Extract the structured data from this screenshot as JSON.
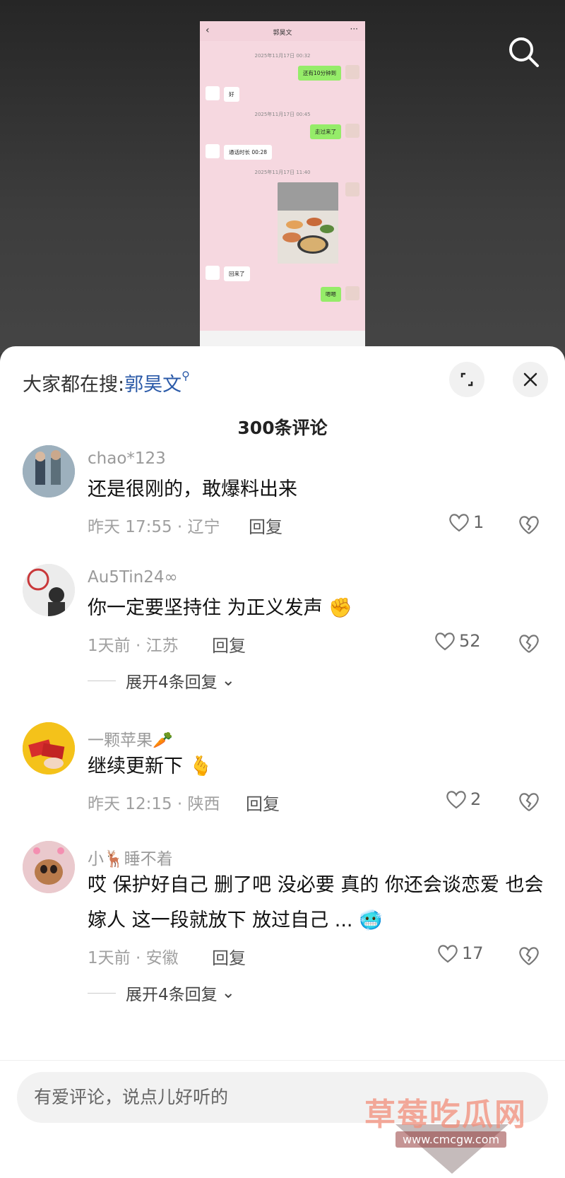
{
  "phone_chat": {
    "title": "郭昊文",
    "timestamps": [
      "2025年11月17日 00:32",
      "2025年11月17日 00:45",
      "2025年11月17日 11:40"
    ],
    "messages": [
      {
        "side": "right",
        "text": "还有10分钟到"
      },
      {
        "side": "left",
        "text": "好"
      },
      {
        "side": "right",
        "text": "走过来了"
      },
      {
        "side": "left",
        "text": "通话时长 00:28"
      },
      {
        "side": "left",
        "text": "回来了"
      },
      {
        "side": "right",
        "text": "嗯嗯"
      }
    ]
  },
  "sheet": {
    "search_prefix": "大家都在搜:",
    "search_keyword": "郭昊文",
    "comment_count": "300条评论"
  },
  "comments": [
    {
      "user": "chao*123",
      "text": "还是很刚的，敢爆料出来",
      "meta": "昨天 17:55 · 辽宁",
      "reply": "回复",
      "likes": "1"
    },
    {
      "user": "Au5Tin24∞",
      "text": "你一定要坚持住 为正义发声 ✊",
      "meta": "1天前 · 江苏",
      "reply": "回复",
      "likes": "52",
      "expand": "展开4条回复"
    },
    {
      "user": "一颗苹果🥕",
      "text": "继续更新下 🫰",
      "meta": "昨天 12:15 · 陕西",
      "reply": "回复",
      "likes": "2"
    },
    {
      "user": "小🦌睡不着",
      "text": "哎 保护好自己 删了吧 没必要 真的 你还会谈恋爱 也会嫁人 这一段就放下 放过自己 ... 🥶",
      "meta": "1天前 · 安徽",
      "reply": "回复",
      "likes": "17",
      "expand": "展开4条回复"
    }
  ],
  "input": {
    "placeholder": "有爱评论，说点儿好听的"
  },
  "watermark": {
    "text": "草莓吃瓜网",
    "url": "www.cmcgw.com"
  },
  "icons": [
    "search-icon",
    "expand-icon",
    "close-icon",
    "heart-icon",
    "broken-heart-icon",
    "chevron-down-icon"
  ]
}
